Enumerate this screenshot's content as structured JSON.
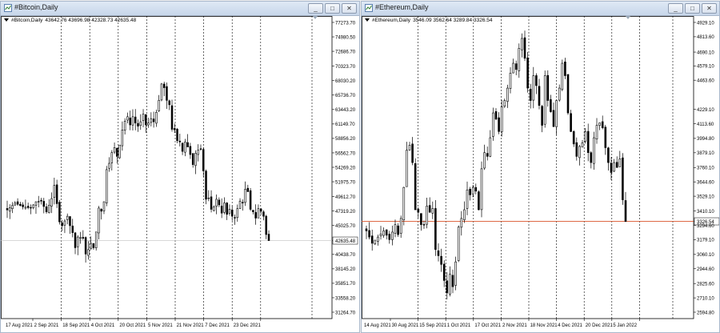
{
  "windows": [
    {
      "title": "#Bitcoin,Daily",
      "info": {
        "symbol": "#Bitcoin,Daily",
        "ohlc": "43642.76 43696.98 42328.73 42635.48"
      },
      "buttons": [
        "_",
        "□",
        "✕"
      ]
    },
    {
      "title": "#Ethereum,Daily",
      "info": {
        "symbol": "#Ethereum,Daily",
        "ohlc": "3546.09 3562.64 3289.84 3326.54"
      },
      "buttons": [
        "_",
        "□",
        "✕"
      ]
    }
  ],
  "chart_data": [
    {
      "type": "candlestick",
      "symbol": "#Bitcoin,Daily",
      "y_ticks": [
        "77273.70",
        "74980.50",
        "72686.70",
        "70323.70",
        "68030.20",
        "65736.70",
        "63443.20",
        "61149.70",
        "58856.20",
        "56562.70",
        "54269.20",
        "51975.70",
        "49612.70",
        "47319.20",
        "45025.70",
        "42635.48",
        "40438.70",
        "38145.20",
        "35851.70",
        "33558.20",
        "31264.70"
      ],
      "ylim": [
        31264.7,
        77273.7
      ],
      "x_ticks": [
        "17 Aug 2021",
        "2 Sep 2021",
        "18 Sep 2021",
        "4 Oct 2021",
        "20 Oct 2021",
        "5 Nov 2021",
        "21 Nov 2021",
        "7 Dec 2021",
        "23 Dec 2021"
      ],
      "current_price": 42635.48,
      "current_price_label": "42635.48",
      "close_path": [
        [
          0,
          47500
        ],
        [
          3,
          48600
        ],
        [
          6,
          48000
        ],
        [
          9,
          47800
        ],
        [
          11,
          48800
        ],
        [
          13,
          48900
        ],
        [
          15,
          47200
        ],
        [
          17,
          49300
        ],
        [
          18,
          51400
        ],
        [
          20,
          45600
        ],
        [
          21,
          45000
        ],
        [
          23,
          46500
        ],
        [
          24,
          45000
        ],
        [
          25,
          43900
        ],
        [
          26,
          41500
        ],
        [
          27,
          43200
        ],
        [
          29,
          43000
        ],
        [
          30,
          40500
        ],
        [
          31,
          41200
        ],
        [
          32,
          42200
        ],
        [
          33,
          41500
        ],
        [
          34,
          44000
        ],
        [
          35,
          47800
        ],
        [
          36,
          47300
        ],
        [
          37,
          48800
        ],
        [
          38,
          53900
        ],
        [
          39,
          54900
        ],
        [
          40,
          56600
        ],
        [
          41,
          57400
        ],
        [
          42,
          56000
        ],
        [
          43,
          57800
        ],
        [
          44,
          60200
        ],
        [
          45,
          61600
        ],
        [
          46,
          62300
        ],
        [
          47,
          61000
        ],
        [
          48,
          62300
        ],
        [
          49,
          61300
        ],
        [
          50,
          60800
        ],
        [
          51,
          61500
        ],
        [
          52,
          62700
        ],
        [
          53,
          61000
        ],
        [
          54,
          61300
        ],
        [
          55,
          62000
        ],
        [
          56,
          61500
        ],
        [
          57,
          63000
        ],
        [
          58,
          64900
        ],
        [
          59,
          67500
        ],
        [
          60,
          66900
        ],
        [
          61,
          64900
        ],
        [
          62,
          64200
        ],
        [
          63,
          60300
        ],
        [
          64,
          60200
        ],
        [
          65,
          58500
        ],
        [
          66,
          58300
        ],
        [
          67,
          56800
        ],
        [
          68,
          58300
        ],
        [
          69,
          57500
        ],
        [
          70,
          56300
        ],
        [
          71,
          54700
        ],
        [
          72,
          56500
        ],
        [
          73,
          57000
        ],
        [
          74,
          57200
        ],
        [
          75,
          53700
        ],
        [
          76,
          49200
        ],
        [
          77,
          49400
        ],
        [
          78,
          47600
        ],
        [
          79,
          48000
        ],
        [
          80,
          49200
        ],
        [
          81,
          48300
        ],
        [
          82,
          47000
        ],
        [
          83,
          48600
        ],
        [
          84,
          46800
        ],
        [
          85,
          47600
        ],
        [
          86,
          46500
        ],
        [
          87,
          46200
        ],
        [
          88,
          47700
        ],
        [
          89,
          48900
        ],
        [
          90,
          48600
        ],
        [
          91,
          50800
        ],
        [
          92,
          50400
        ],
        [
          93,
          47600
        ],
        [
          94,
          47200
        ],
        [
          95,
          46200
        ],
        [
          96,
          47700
        ],
        [
          97,
          47300
        ],
        [
          98,
          46500
        ],
        [
          99,
          43600
        ],
        [
          100,
          42635
        ]
      ]
    },
    {
      "type": "candlestick",
      "symbol": "#Ethereum,Daily",
      "y_ticks": [
        "4929.10",
        "4813.60",
        "4690.10",
        "4579.10",
        "4463.60",
        "4229.10",
        "4113.60",
        "3994.80",
        "3879.10",
        "3760.10",
        "3644.60",
        "3529.10",
        "3410.10",
        "3326.54",
        "3294.60",
        "3179.10",
        "3060.10",
        "2944.60",
        "2825.60",
        "2710.10",
        "2594.80"
      ],
      "ylim": [
        2594.8,
        4929.1
      ],
      "x_ticks": [
        "14 Aug 2021",
        "30 Aug 2021",
        "15 Sep 2021",
        "1 Oct 2021",
        "17 Oct 2021",
        "2 Nov 2021",
        "18 Nov 2021",
        "4 Dec 2021",
        "20 Dec 2021",
        "5 Jan 2022"
      ],
      "current_price": 3326.54,
      "current_price_label": "3326.54",
      "close_path": [
        [
          0,
          3250
        ],
        [
          2,
          3150
        ],
        [
          4,
          3200
        ],
        [
          6,
          3250
        ],
        [
          8,
          3180
        ],
        [
          10,
          3300
        ],
        [
          11,
          3220
        ],
        [
          12,
          3350
        ],
        [
          13,
          3600
        ],
        [
          14,
          3900
        ],
        [
          15,
          3940
        ],
        [
          16,
          3800
        ],
        [
          17,
          3420
        ],
        [
          18,
          3400
        ],
        [
          19,
          3300
        ],
        [
          20,
          3300
        ],
        [
          21,
          3450
        ],
        [
          22,
          3400
        ],
        [
          23,
          3430
        ],
        [
          24,
          3100
        ],
        [
          25,
          3050
        ],
        [
          26,
          2980
        ],
        [
          27,
          2850
        ],
        [
          28,
          2750
        ],
        [
          29,
          2900
        ],
        [
          30,
          2800
        ],
        [
          31,
          3000
        ],
        [
          32,
          3280
        ],
        [
          33,
          3350
        ],
        [
          34,
          3420
        ],
        [
          35,
          3580
        ],
        [
          36,
          3540
        ],
        [
          37,
          3600
        ],
        [
          38,
          3570
        ],
        [
          39,
          3420
        ],
        [
          40,
          3750
        ],
        [
          41,
          3880
        ],
        [
          42,
          3850
        ],
        [
          43,
          4000
        ],
        [
          44,
          4200
        ],
        [
          45,
          4150
        ],
        [
          46,
          4050
        ],
        [
          47,
          4250
        ],
        [
          48,
          4300
        ],
        [
          49,
          4400
        ],
        [
          50,
          4520
        ],
        [
          51,
          4600
        ],
        [
          52,
          4550
        ],
        [
          53,
          4720
        ],
        [
          54,
          4800
        ],
        [
          55,
          4640
        ],
        [
          56,
          4400
        ],
        [
          57,
          4300
        ],
        [
          58,
          4500
        ],
        [
          59,
          4420
        ],
        [
          60,
          4260
        ],
        [
          61,
          4100
        ],
        [
          62,
          4500
        ],
        [
          63,
          4300
        ],
        [
          64,
          4210
        ],
        [
          65,
          4090
        ],
        [
          66,
          4300
        ],
        [
          67,
          4400
        ],
        [
          68,
          4600
        ],
        [
          69,
          4500
        ],
        [
          70,
          4200
        ],
        [
          71,
          4050
        ],
        [
          72,
          3950
        ],
        [
          73,
          3850
        ],
        [
          74,
          3930
        ],
        [
          75,
          3960
        ],
        [
          76,
          4050
        ],
        [
          77,
          3880
        ],
        [
          78,
          3800
        ],
        [
          79,
          4000
        ],
        [
          80,
          4100
        ],
        [
          81,
          4120
        ],
        [
          82,
          4080
        ],
        [
          83,
          3920
        ],
        [
          84,
          3800
        ],
        [
          85,
          3720
        ],
        [
          86,
          3800
        ],
        [
          87,
          3760
        ],
        [
          88,
          3830
        ],
        [
          89,
          3500
        ],
        [
          90,
          3326
        ]
      ]
    }
  ]
}
